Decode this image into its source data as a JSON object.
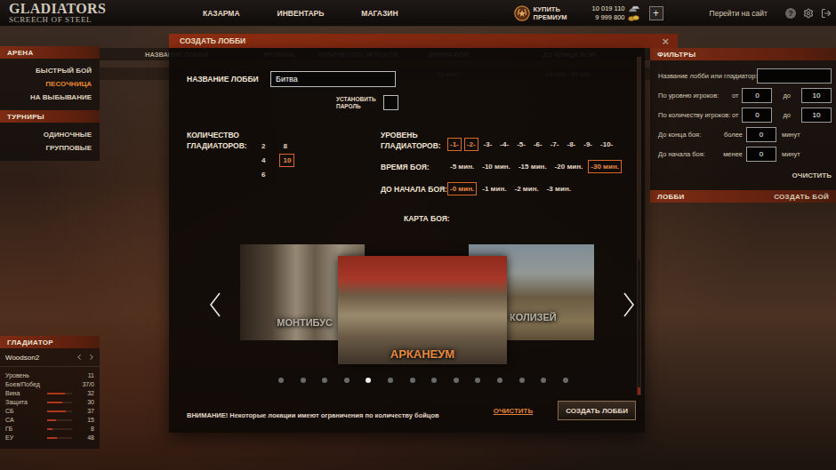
{
  "header": {
    "logo": {
      "title": "GLADIATORS",
      "subtitle": "SCREECH OF STEEL"
    },
    "nav": [
      "КАЗАРМА",
      "ИНВЕНТАРЬ",
      "МАГАЗИН"
    ],
    "premium": {
      "lines": [
        "КУПИТЬ",
        "ПРЕМИУМ"
      ]
    },
    "currency": [
      {
        "amount": "10 019 110",
        "kind": "silver"
      },
      {
        "amount": "9 999 800",
        "kind": "gold"
      }
    ],
    "add": "+",
    "site_link": "Перейти на сайт",
    "help": "?"
  },
  "sidebar": {
    "sections": [
      {
        "title": "АРЕНА",
        "items": [
          {
            "label": "БЫСТРЫЙ БОЙ",
            "selected": false
          },
          {
            "label": "ПЕСОЧНИЦА",
            "selected": true
          },
          {
            "label": "НА ВЫБЫВАНИЕ",
            "selected": false
          }
        ]
      },
      {
        "title": "ТУРНИРЫ",
        "items": [
          {
            "label": "ОДИНОЧНЫЕ",
            "selected": false
          },
          {
            "label": "ГРУППОВЫЕ",
            "selected": false
          }
        ]
      }
    ]
  },
  "gladiator": {
    "title": "ГЛАДИАТОР",
    "name": "Woodson2",
    "stats": [
      {
        "label": "Уровень",
        "value": "11",
        "kind": "text"
      },
      {
        "label": "Боев/Побед",
        "value": "37/0",
        "kind": "text"
      },
      {
        "label": "Вина",
        "value": "32",
        "kind": "bar",
        "level": 0.7
      },
      {
        "label": "Защита",
        "value": "30",
        "kind": "bar",
        "level": 0.62
      },
      {
        "label": "СБ",
        "value": "37",
        "kind": "bar",
        "level": 0.75
      },
      {
        "label": "СА",
        "value": "15",
        "kind": "bar",
        "level": 0.35
      },
      {
        "label": "ГБ",
        "value": "8",
        "kind": "bar",
        "level": 0.2
      },
      {
        "label": "ЕУ",
        "value": "48",
        "kind": "bar",
        "level": 0.4
      }
    ]
  },
  "lobby_table": {
    "columns": [
      "НАЗВАНИЕ ЛОББИ",
      "УРОВЕНЬ",
      "КОЛИЧЕСТВО ИГРОКОВ",
      "ВРЕМЯ БОЯ",
      "ДО КОНЦА БОЯ"
    ],
    "rows": [
      {
        "players": "2/10",
        "time": "30 мин.",
        "remaining": "24 мин. 49 сек."
      }
    ]
  },
  "filters": {
    "title": "ФИЛЬТРЫ",
    "search_label": "Название лобби или гладиатор:",
    "rows": [
      {
        "kind": "range",
        "label": "По уровню игроков:",
        "from_label": "от",
        "from": "0",
        "to_label": "до",
        "to": "10"
      },
      {
        "kind": "range",
        "label": "По количеству игроков:",
        "from_label": "от",
        "from": "0",
        "to_label": "до",
        "to": "10"
      },
      {
        "kind": "threshold",
        "label": "До конца боя:",
        "compare": "более",
        "value": "0",
        "unit": "минут"
      },
      {
        "kind": "threshold",
        "label": "До начала боя:",
        "compare": "менее",
        "value": "0",
        "unit": "минут"
      }
    ],
    "clear": "ОЧИСТИТЬ"
  },
  "lobby_panel": {
    "title": "ЛОББИ",
    "action": "СОЗДАТЬ БОЙ"
  },
  "modal": {
    "title": "СОЗДАТЬ ЛОББИ",
    "close": "×",
    "name_label": "НАЗВАНИЕ ЛОББИ",
    "name_value": "Битва",
    "password": {
      "lines": [
        "УСТАНОВИТЬ",
        "ПАРОЛЬ"
      ],
      "checked": false
    },
    "count": {
      "lines": [
        "КОЛИЧЕСТВО",
        "ГЛАДИАТОРОВ:"
      ],
      "options": [
        {
          "label": "2",
          "selected": false
        },
        {
          "label": "4",
          "selected": false
        },
        {
          "label": "6",
          "selected": false
        },
        {
          "label": "8",
          "selected": false
        },
        {
          "label": "10",
          "selected": true
        }
      ]
    },
    "level": {
      "lines": [
        "УРОВЕНЬ",
        "ГЛАДИАТОРОВ:"
      ],
      "options": [
        {
          "label": "-1-",
          "selected": true
        },
        {
          "label": "-2-",
          "selected": true
        },
        {
          "label": "-3-",
          "selected": false
        },
        {
          "label": "-4-",
          "selected": false
        },
        {
          "label": "-5-",
          "selected": false
        },
        {
          "label": "-6-",
          "selected": false
        },
        {
          "label": "-7-",
          "selected": false
        },
        {
          "label": "-8-",
          "selected": false
        },
        {
          "label": "-9-",
          "selected": false
        },
        {
          "label": "-10-",
          "selected": false
        }
      ]
    },
    "time": {
      "label": "ВРЕМЯ БОЯ:",
      "options": [
        {
          "label": "-5 мин.",
          "selected": false
        },
        {
          "label": "-10 мин.",
          "selected": false
        },
        {
          "label": "-15 мин.",
          "selected": false
        },
        {
          "label": "-20 мин.",
          "selected": false
        },
        {
          "label": "-30 мин.",
          "selected": true
        }
      ]
    },
    "start": {
      "label": "ДО НАЧАЛА БОЯ:",
      "options": [
        {
          "label": "-0 мин.",
          "selected": true
        },
        {
          "label": "-1 мин.",
          "selected": false
        },
        {
          "label": "-2 мин.",
          "selected": false
        },
        {
          "label": "-3 мин.",
          "selected": false
        }
      ]
    },
    "map": {
      "label": "КАРТА БОЯ:",
      "cards": [
        {
          "name": "МОНТИБУС",
          "selected": false
        },
        {
          "name": "АРКАНЕУМ",
          "selected": true
        },
        {
          "name": "КОЛИЗЕЙ",
          "selected": false
        }
      ],
      "dots": [
        {
          "selected": false
        },
        {
          "selected": false
        },
        {
          "selected": false
        },
        {
          "selected": false
        },
        {
          "selected": true
        },
        {
          "selected": false
        },
        {
          "selected": false
        },
        {
          "selected": false
        },
        {
          "selected": false
        },
        {
          "selected": false
        },
        {
          "selected": false
        },
        {
          "selected": false
        },
        {
          "selected": false
        },
        {
          "selected": false
        }
      ]
    },
    "warning": "ВНИМАНИЕ! Некоторые локации имеют ограничения по количеству бойцов",
    "clear": "ОЧИСТИТЬ",
    "submit": "СОЗДАТЬ ЛОББИ"
  }
}
